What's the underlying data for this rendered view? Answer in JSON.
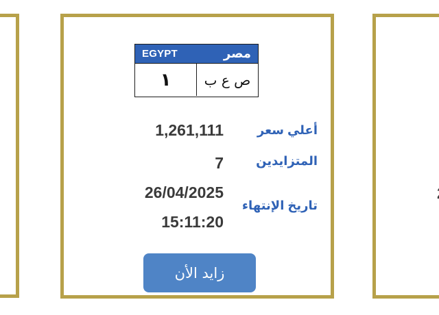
{
  "plate": {
    "country_en": "EGYPT",
    "country_ar": "مصر",
    "number": "١",
    "letters": "ص ع ب"
  },
  "details": {
    "highest_price_label": "أعلي سعر",
    "highest_price_value": "1,261,111",
    "bidders_label": "المتزايدين",
    "bidders_value": "7",
    "end_date_label": "تاريخ الإنتهاء",
    "end_date_value": "26/04/2025",
    "end_time_value": "15:11:20"
  },
  "actions": {
    "bid_now_label": "زايد الأن"
  },
  "right_card": {
    "peek_text": "2"
  },
  "colors": {
    "card_border": "#b7a14a",
    "plate_header": "#2f62b6",
    "label_blue": "#2f62b6",
    "button_blue": "#4f84c6",
    "value_gray": "#3a3a3a"
  }
}
